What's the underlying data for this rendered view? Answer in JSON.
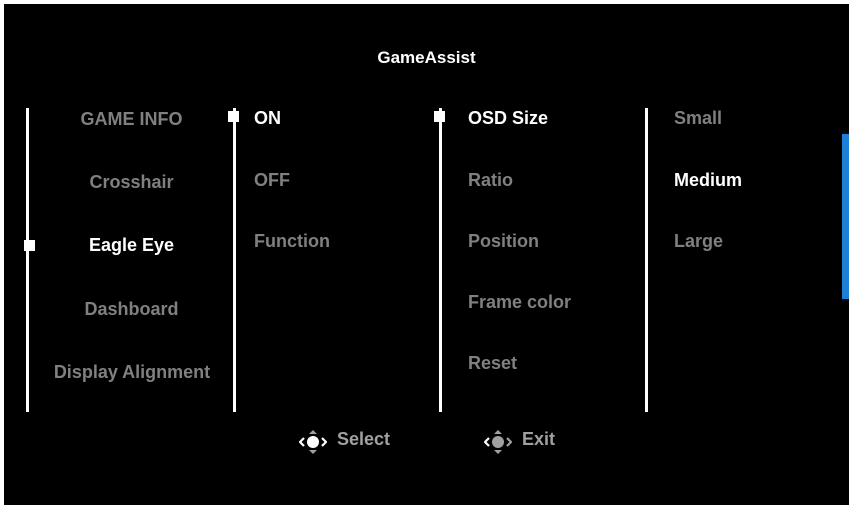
{
  "title": "GameAssist",
  "col1": {
    "items": [
      {
        "label": "GAME INFO"
      },
      {
        "label": "Crosshair"
      },
      {
        "label": "Eagle Eye"
      },
      {
        "label": "Dashboard"
      },
      {
        "label": "Display Alignment"
      }
    ],
    "selected_index": 2
  },
  "col2": {
    "items": [
      {
        "label": "ON"
      },
      {
        "label": "OFF"
      },
      {
        "label": "Function"
      }
    ],
    "selected_index": 0
  },
  "col3": {
    "items": [
      {
        "label": "OSD Size"
      },
      {
        "label": "Ratio"
      },
      {
        "label": "Position"
      },
      {
        "label": "Frame color"
      },
      {
        "label": "Reset"
      }
    ],
    "selected_index": 0
  },
  "col4": {
    "items": [
      {
        "label": "Small"
      },
      {
        "label": "Medium"
      },
      {
        "label": "Large"
      }
    ],
    "selected_index": 1
  },
  "footer": {
    "select_label": "Select",
    "exit_label": "Exit"
  },
  "colors": {
    "scroll_indicator": "#1e7fd6",
    "inactive_text": "#808080"
  }
}
